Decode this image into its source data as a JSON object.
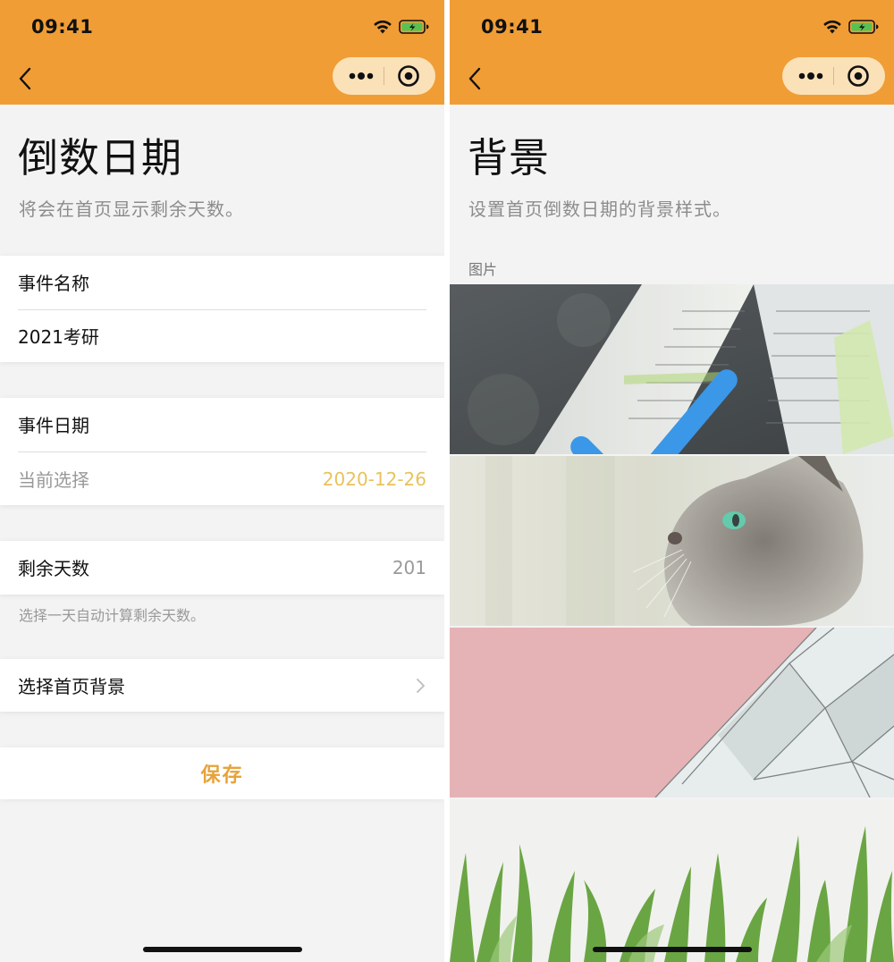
{
  "status_bar": {
    "time": "09:41"
  },
  "colors": {
    "topbar": "#f09d35",
    "accent": "#e7a33a",
    "date_value": "#e9c25c",
    "check": "#3b97e8"
  },
  "left": {
    "title": "倒数日期",
    "subtitle": "将会在首页显示剩余天数。",
    "event_name": {
      "label": "事件名称",
      "value": "2021考研"
    },
    "event_date": {
      "label": "事件日期",
      "current_label": "当前选择",
      "current_value": "2020-12-26"
    },
    "remaining": {
      "label": "剩余天数",
      "value": "201",
      "hint": "选择一天自动计算剩余天数。"
    },
    "background_row": {
      "label": "选择首页背景"
    },
    "save_label": "保存"
  },
  "right": {
    "title": "背景",
    "subtitle": "设置首页倒数日期的背景样式。",
    "section_label": "图片",
    "options": [
      {
        "name": "book",
        "selected": true
      },
      {
        "name": "cat",
        "selected": false
      },
      {
        "name": "pink-wall",
        "selected": false
      },
      {
        "name": "grass",
        "selected": false
      }
    ]
  },
  "icons": [
    "back-icon",
    "more-icon",
    "close-icon",
    "wifi-icon",
    "battery-icon",
    "chevron-right-icon",
    "check-icon"
  ]
}
